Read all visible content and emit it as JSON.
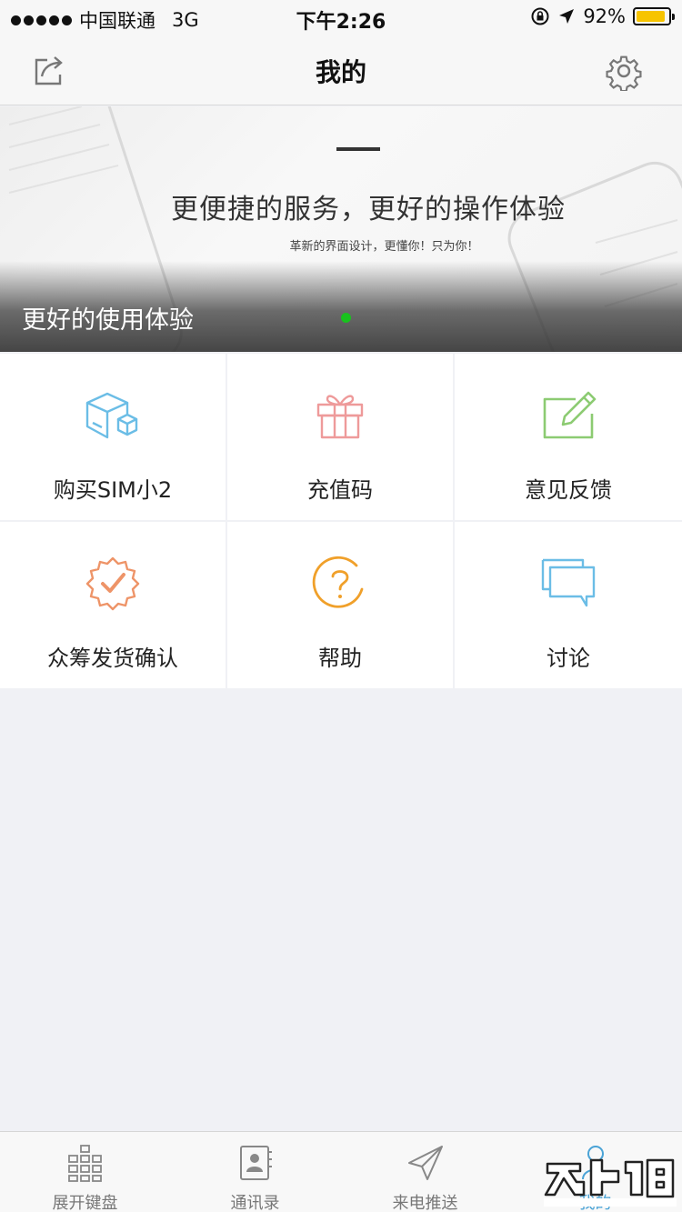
{
  "status_bar": {
    "carrier": "中国联通",
    "network": "3G",
    "time": "下午2:26",
    "battery": "92%",
    "battery_level": 0.92,
    "battery_color": "#f7c400"
  },
  "header": {
    "title": "我的",
    "left_icon": "share-icon",
    "right_icon": "gear-icon"
  },
  "banner": {
    "headline": "更便捷的服务，更好的操作体验",
    "subtext": "革新的界面设计，更懂你！只为你！",
    "caption": "更好的使用体验",
    "active_dot_color": "#19c21e"
  },
  "grid": {
    "items": [
      {
        "label": "购买SIM小2",
        "icon": "box-icon",
        "color": "#6bbde6"
      },
      {
        "label": "充值码",
        "icon": "gift-icon",
        "color": "#ee9a9a"
      },
      {
        "label": "意见反馈",
        "icon": "edit-icon",
        "color": "#8ccb72"
      },
      {
        "label": "众筹发货确认",
        "icon": "badge-check-icon",
        "color": "#ee9468"
      },
      {
        "label": "帮助",
        "icon": "help-icon",
        "color": "#f0a02a"
      },
      {
        "label": "讨论",
        "icon": "chat-icon",
        "color": "#6bbde6"
      }
    ]
  },
  "tabbar": {
    "tabs": [
      {
        "label": "展开键盘",
        "icon": "keypad-icon"
      },
      {
        "label": "通讯录",
        "icon": "contacts-icon"
      },
      {
        "label": "来电推送",
        "icon": "send-icon"
      },
      {
        "label": "我的",
        "icon": "person-icon",
        "active": true
      }
    ],
    "active_color": "#4aa3d6"
  }
}
